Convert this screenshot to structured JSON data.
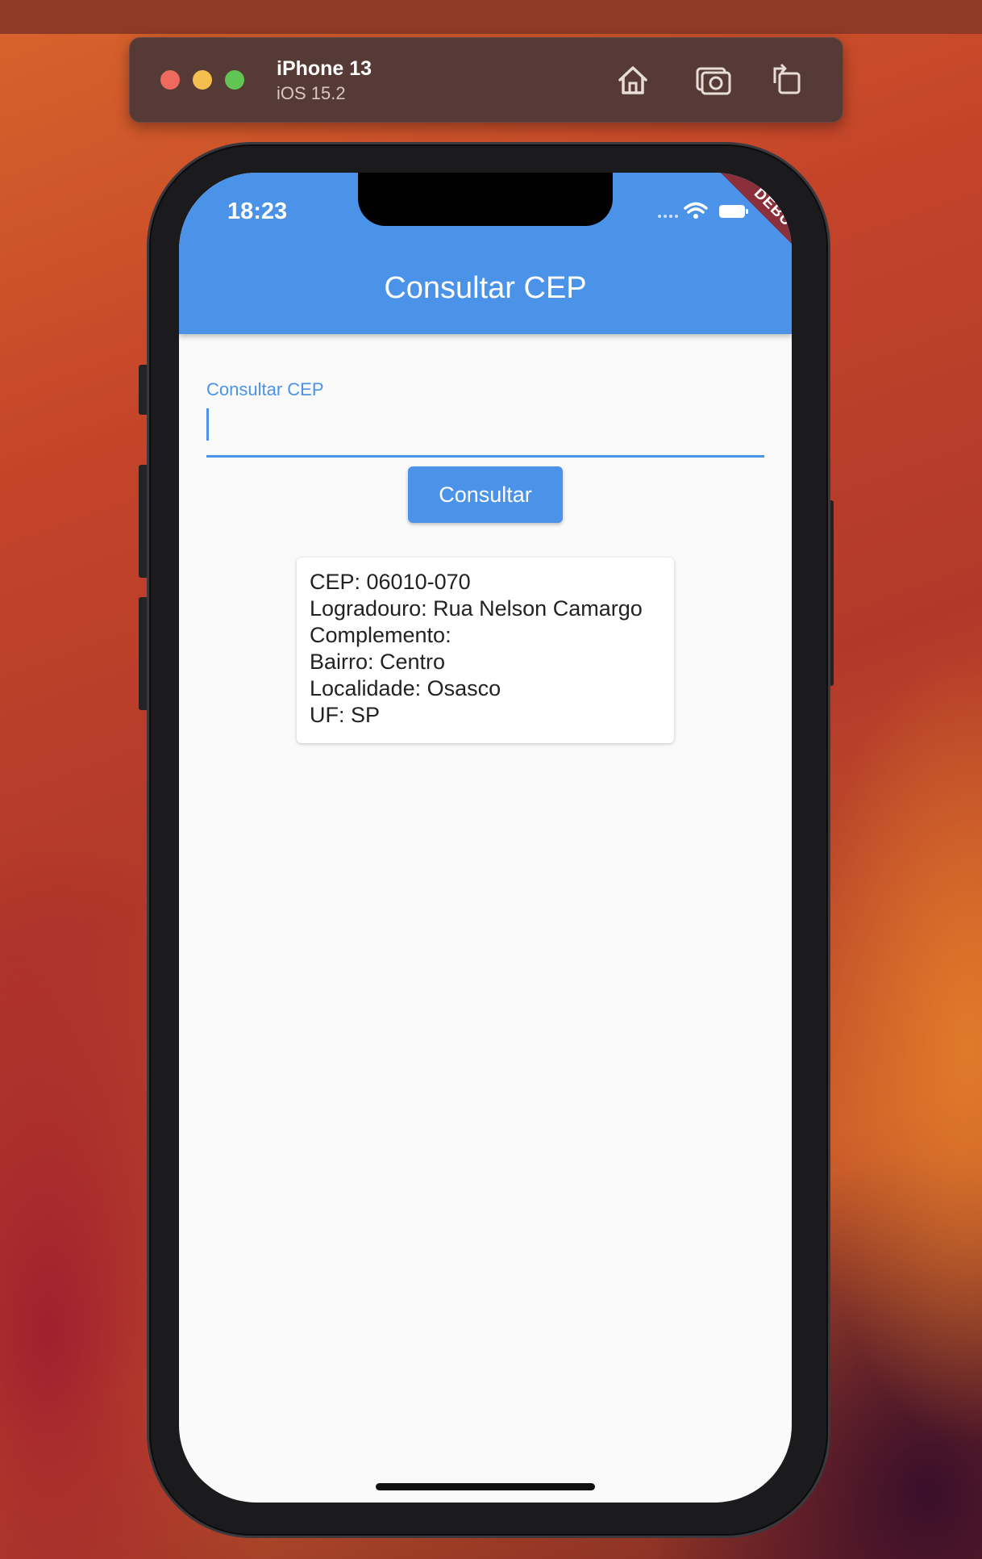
{
  "simulator": {
    "device_name": "iPhone 13",
    "os_version": "iOS 15.2",
    "icons": [
      "home-icon",
      "screenshot-icon",
      "rotate-icon"
    ]
  },
  "status_bar": {
    "time": "18:23",
    "debug_banner": "DEBUG"
  },
  "app": {
    "title": "Consultar CEP",
    "accent_color": "#4b93e9",
    "field": {
      "label": "Consultar CEP",
      "value": ""
    },
    "button_label": "Consultar",
    "result": {
      "cep": "CEP: 06010-070",
      "logradouro": "Logradouro: Rua Nelson Camargo",
      "complemento": "Complemento:",
      "bairro": "Bairro: Centro",
      "localidade": "Localidade: Osasco",
      "uf": "UF: SP"
    }
  }
}
